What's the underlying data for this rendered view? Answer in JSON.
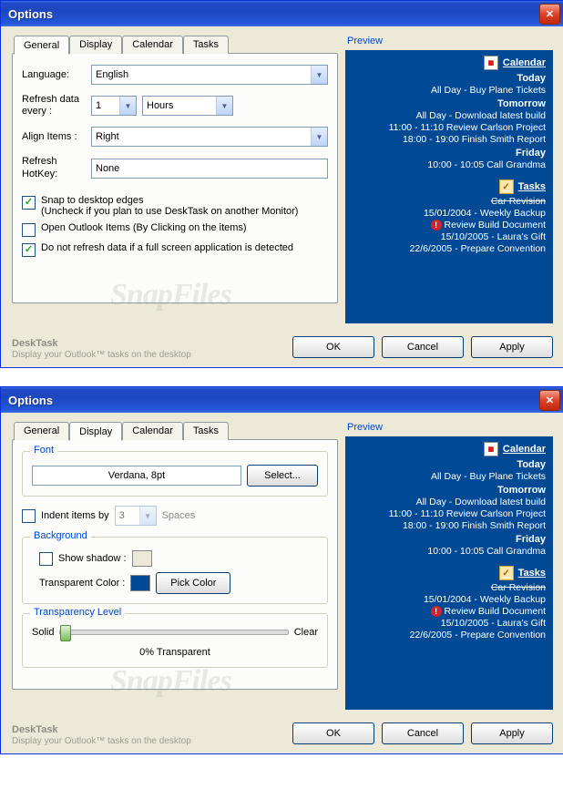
{
  "window": {
    "title": "Options"
  },
  "tabs": {
    "general": "General",
    "display": "Display",
    "calendar": "Calendar",
    "tasks": "Tasks"
  },
  "general": {
    "language_label": "Language:",
    "language_value": "English",
    "refresh_label": "Refresh data every :",
    "refresh_num": "1",
    "refresh_unit": "Hours",
    "align_label": "Align Items :",
    "align_value": "Right",
    "hotkey_label": "Refresh HotKey:",
    "hotkey_value": "None",
    "chk_snap": "Snap to desktop edges",
    "chk_snap_hint": "(Uncheck if you plan to use DeskTask on another Monitor)",
    "chk_open": "Open Outlook Items (By Clicking on the items)",
    "chk_norefresh": "Do not refresh data if a full screen application is detected"
  },
  "display": {
    "font_group": "Font",
    "font_value": "Verdana, 8pt",
    "select_btn": "Select...",
    "indent_label": "Indent items by",
    "indent_num": "3",
    "indent_unit": "Spaces",
    "bg_group": "Background",
    "shadow_label": "Show shadow :",
    "shadow_color": "#ece9d8",
    "trans_label": "Transparent Color :",
    "trans_color": "#004a95",
    "pick_btn": "Pick Color",
    "tl_group": "Transparency Level",
    "tl_solid": "Solid",
    "tl_clear": "Clear",
    "tl_value": "0% Transparent"
  },
  "preview": {
    "label": "Preview",
    "cal_head": "Calendar",
    "today": "Today",
    "today_1": "All Day - Buy Plane Tickets",
    "tomorrow": "Tomorrow",
    "tom_1": "All Day - Download latest build",
    "tom_2": "11:00 - 11:10 Review Carlson Project",
    "tom_3": "18:00 - 19:00 Finish Smith Report",
    "friday": "Friday",
    "fri_1": "10:00 - 10:05 Call Grandma",
    "tasks_head": "Tasks",
    "task_strike": "Car Revision",
    "task_2": "15/01/2004 - Weekly Backup",
    "task_3": "Review Build Document",
    "task_4": "15/10/2005 - Laura's Gift",
    "task_5": "22/6/2005 - Prepare Convention"
  },
  "buttons": {
    "ok": "OK",
    "cancel": "Cancel",
    "apply": "Apply"
  },
  "brand": {
    "name": "DeskTask",
    "tagline": "Display your Outlook™ tasks on the desktop"
  },
  "watermark": "SnapFiles"
}
